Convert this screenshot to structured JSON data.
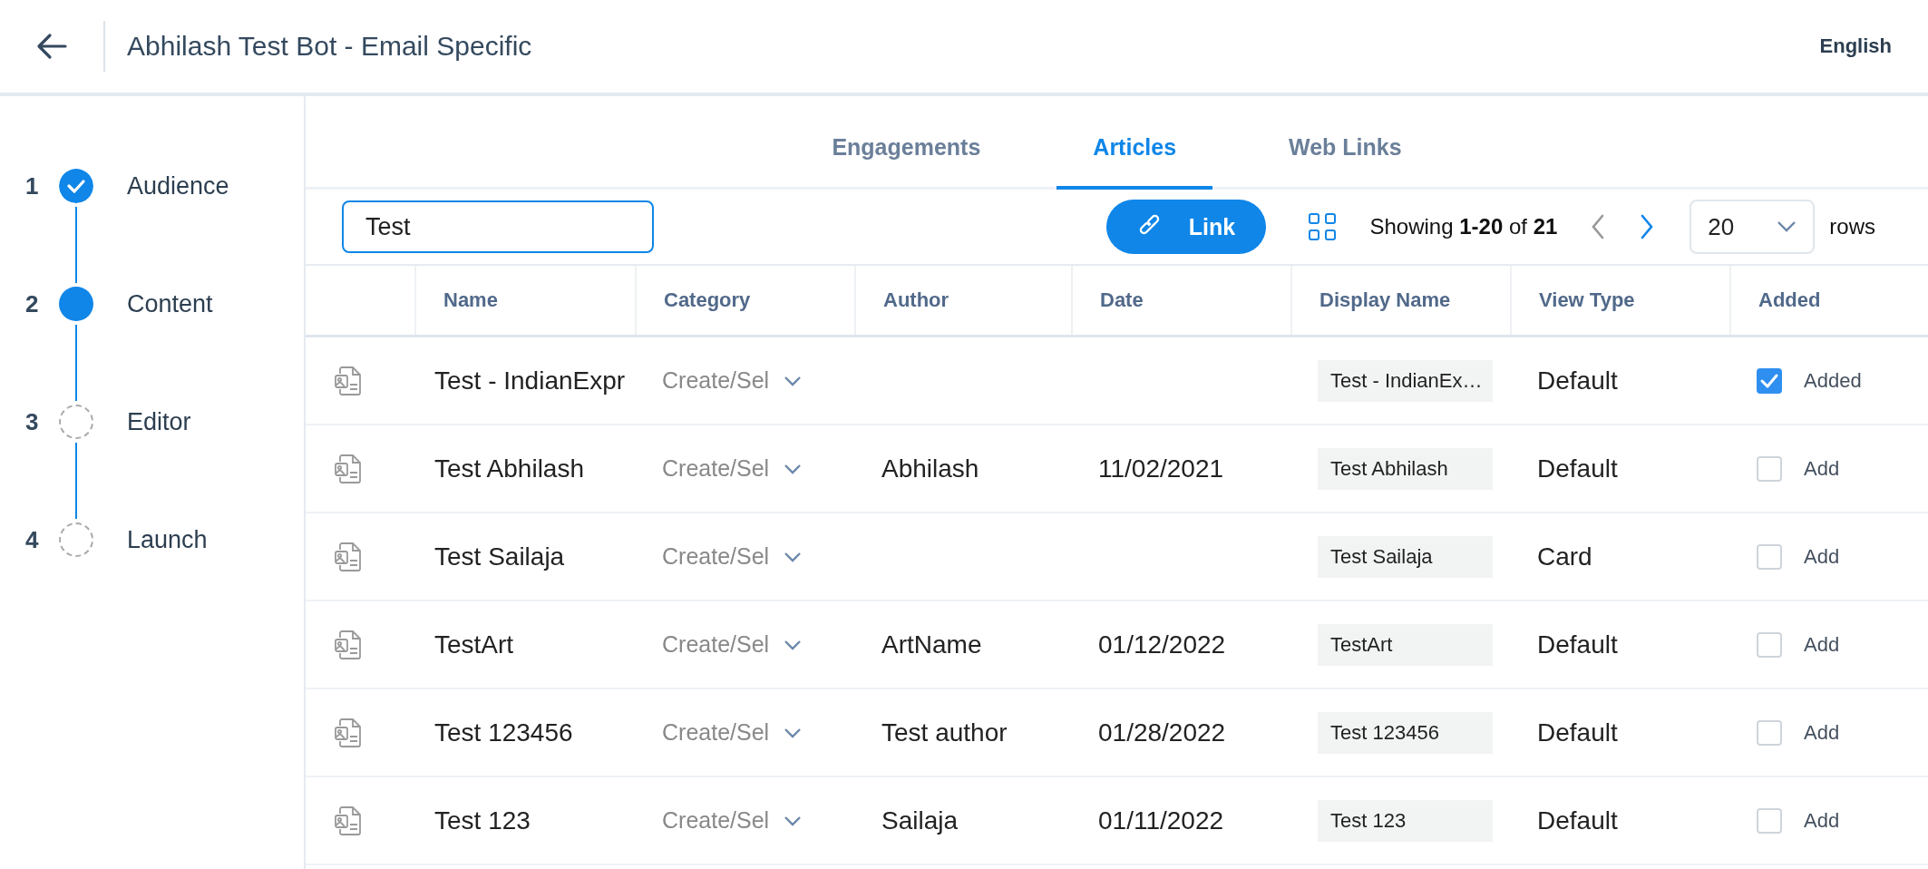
{
  "header": {
    "title": "Abhilash Test Bot - Email Specific",
    "language": "English"
  },
  "steps": [
    {
      "number": "1",
      "label": "Audience",
      "kind": "done"
    },
    {
      "number": "2",
      "label": "Content",
      "kind": "current"
    },
    {
      "number": "3",
      "label": "Editor",
      "kind": "pending"
    },
    {
      "number": "4",
      "label": "Launch",
      "kind": "pending"
    }
  ],
  "tabs": [
    {
      "label": "Engagements",
      "selected": false
    },
    {
      "label": "Articles",
      "selected": true
    },
    {
      "label": "Web Links",
      "selected": false
    }
  ],
  "toolbar": {
    "search": {
      "value": "Test"
    },
    "link_button": "Link",
    "showing": "Showing **1-20** of **21**",
    "page_size": "20",
    "rows_label": "rows"
  },
  "table": {
    "columns": [
      "Name",
      "Category",
      "Author",
      "Date",
      "Display Name",
      "View Type",
      "Added"
    ],
    "rows": [
      {
        "name": "Test - IndianExpr",
        "category": "Create/Sel",
        "author": "",
        "date": "",
        "display_name": "Test - IndianEx…",
        "view_type": "Default",
        "added": true,
        "added_label": "Added"
      },
      {
        "name": "Test Abhilash",
        "category": "Create/Sel",
        "author": "Abhilash",
        "date": "11/02/2021",
        "display_name": "Test Abhilash",
        "view_type": "Default",
        "added": false,
        "added_label": "Add"
      },
      {
        "name": "Test Sailaja",
        "category": "Create/Sel",
        "author": "",
        "date": "",
        "display_name": "Test Sailaja",
        "view_type": "Card",
        "added": false,
        "added_label": "Add"
      },
      {
        "name": "TestArt",
        "category": "Create/Sel",
        "author": "ArtName",
        "date": "01/12/2022",
        "display_name": "TestArt",
        "view_type": "Default",
        "added": false,
        "added_label": "Add"
      },
      {
        "name": "Test 123456",
        "category": "Create/Sel",
        "author": "Test author",
        "date": "01/28/2022",
        "display_name": "Test 123456",
        "view_type": "Default",
        "added": false,
        "added_label": "Add"
      },
      {
        "name": "Test 123",
        "category": "Create/Sel",
        "author": "Sailaja",
        "date": "01/11/2022",
        "display_name": "Test 123",
        "view_type": "Default",
        "added": false,
        "added_label": "Add"
      }
    ]
  }
}
